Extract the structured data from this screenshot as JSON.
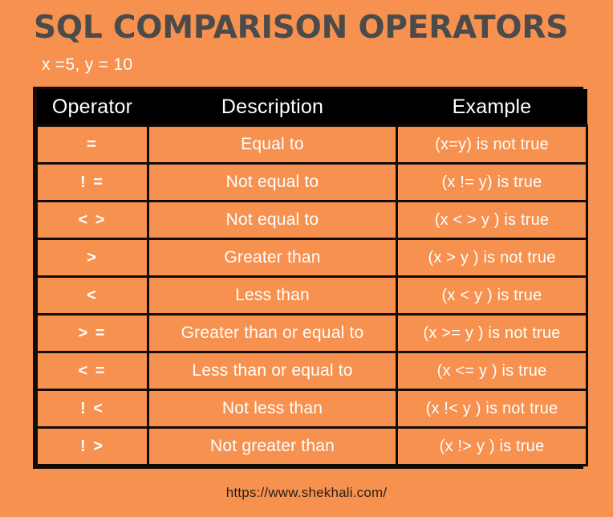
{
  "header": {
    "title": "SQL COMPARISON OPERATORS",
    "subtitle": "x =5, y = 10"
  },
  "colors": {
    "background": "#F7914F",
    "title_text": "#4B4B4B",
    "table_border": "#120B06",
    "header_row_bg": "#000000",
    "cell_text": "#FFFFFF",
    "footer_text": "#2B2118"
  },
  "table": {
    "columns": [
      "Operator",
      "Description",
      "Example"
    ],
    "rows": [
      {
        "operator": "=",
        "description": "Equal to",
        "example": "(x=y) is not true"
      },
      {
        "operator": "! =",
        "description": "Not equal to",
        "example": "(x != y) is true"
      },
      {
        "operator": "< >",
        "description": "Not equal to",
        "example": "(x < > y ) is true"
      },
      {
        "operator": ">",
        "description": "Greater than",
        "example": "(x  > y ) is not true"
      },
      {
        "operator": "<",
        "description": "Less than",
        "example": "(x  < y ) is true"
      },
      {
        "operator": "> =",
        "description": "Greater than or equal to",
        "example": "(x  >= y ) is not true"
      },
      {
        "operator": "< =",
        "description": "Less than or equal to",
        "example": "(x  <= y ) is true"
      },
      {
        "operator": "! <",
        "description": "Not less than",
        "example": "(x  !< y ) is not true"
      },
      {
        "operator": "! >",
        "description": "Not greater than",
        "example": "(x  !> y ) is true"
      }
    ]
  },
  "footer": {
    "url": "https://www.shekhali.com/"
  }
}
